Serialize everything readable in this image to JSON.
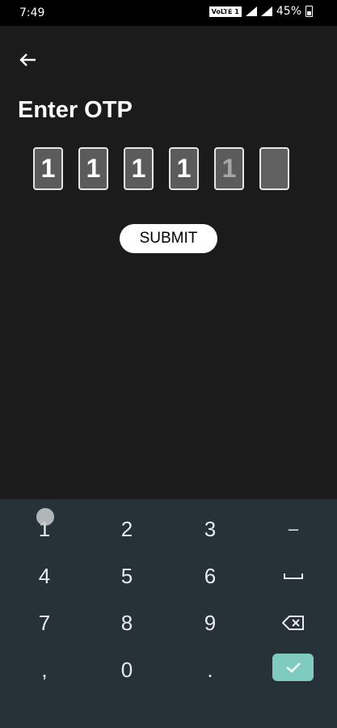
{
  "status_bar": {
    "time": "7:49",
    "network_badge": "VoLTE 1",
    "network_type": "4G",
    "battery": "45%"
  },
  "header": {
    "back_icon": "arrow-left-icon",
    "title": "Enter OTP"
  },
  "otp": {
    "digits": [
      "1",
      "1",
      "1",
      "1",
      "1",
      ""
    ]
  },
  "submit_label": "SUBMIT",
  "keyboard": {
    "rows": [
      [
        "1",
        "2",
        "3",
        "–"
      ],
      [
        "4",
        "5",
        "6",
        "␣"
      ],
      [
        "7",
        "8",
        "9",
        "⌫"
      ],
      [
        ",",
        "0",
        ".",
        "✓"
      ]
    ]
  },
  "colors": {
    "app_background": "#1b1b1b",
    "keyboard_background": "#273238",
    "done_key": "#7fcbc0"
  }
}
